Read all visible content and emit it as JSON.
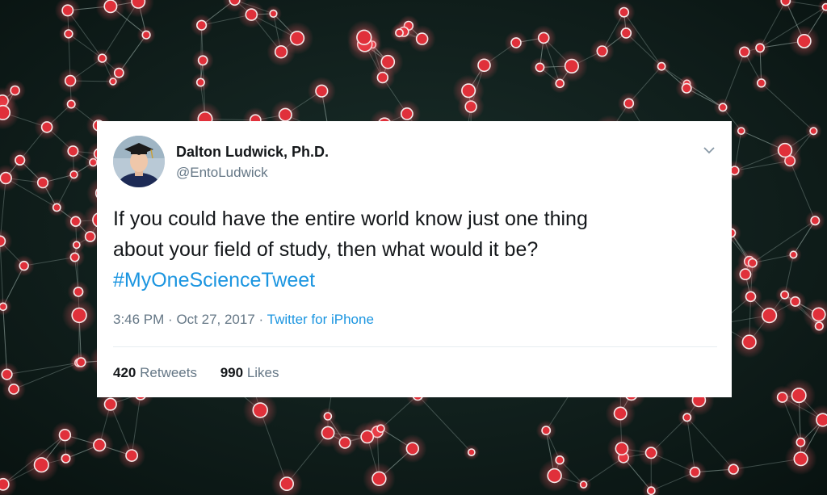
{
  "tweet": {
    "display_name": "Dalton Ludwick, Ph.D.",
    "handle": "@EntoLudwick",
    "text_line1": "If you could have the entire world know just one thing",
    "text_line2": "about your field of study, then what would it be?",
    "hashtag": "#MyOneScienceTweet",
    "time": "3:46 PM",
    "separator": "·",
    "date": "Oct 27, 2017",
    "source": "Twitter for iPhone",
    "retweets_count": "420",
    "retweets_label": "Retweets",
    "likes_count": "990",
    "likes_label": "Likes"
  },
  "icons": {
    "caret": "chevron-down-icon",
    "avatar": "profile-photo"
  },
  "colors": {
    "link": "#1b95e0",
    "secondary": "#657786",
    "primary_text": "#14171a",
    "background": "#0b1a17",
    "node": "#e0303a"
  }
}
